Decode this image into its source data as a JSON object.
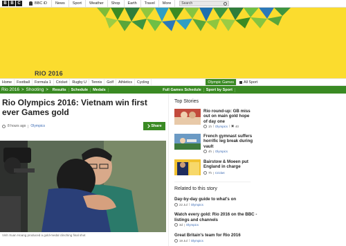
{
  "topbar": {
    "logo": [
      "B",
      "B",
      "C"
    ],
    "signin": "BBC iD",
    "nav": [
      "News",
      "Sport",
      "Weather",
      "Shop",
      "Earth",
      "Travel",
      "More"
    ],
    "search_placeholder": "Search"
  },
  "banner": {
    "title": "RIO 2016",
    "background": "#fbdc2e"
  },
  "sportnav": {
    "items": [
      "Home",
      "Football",
      "Formula 1",
      "Cricket",
      "Rugby U",
      "Tennis",
      "Golf",
      "Athletics",
      "Cycling"
    ],
    "active": "Olympic Games",
    "all_sport": "All Sport"
  },
  "section": {
    "title": "Rio 2016",
    "sub": "Shooting",
    "links": [
      "Results",
      "Schedule",
      "Medals"
    ],
    "right_links": [
      "Full Games Schedule",
      "Sport by Sport"
    ],
    "accent": "#3a8a23"
  },
  "article": {
    "headline": "Rio Olympics 2016: Vietnam win first ever Games gold",
    "time": "8 hours ago",
    "category": "Olympics",
    "share": "Share",
    "caption": "Vinh Xuan Hoang produced a gold-medal clinching final shot"
  },
  "top_stories": {
    "heading": "Top Stories",
    "items": [
      {
        "title": "Rio round-up: GB miss out on main gold hope of day one",
        "time": "1h",
        "category": "Olympics",
        "comments": "40"
      },
      {
        "title": "French gymnast suffers horrific leg break during vault",
        "time": "4h",
        "category": "Olympics"
      },
      {
        "title": "Bairstow & Moeen put England in charge",
        "time": "7h",
        "category": "Cricket"
      }
    ]
  },
  "related": {
    "heading": "Related to this story",
    "items": [
      {
        "title": "Day-by-day guide to what's on",
        "date": "22 Jul",
        "category": "Olympics"
      },
      {
        "title": "Watch every gold: Rio 2016 on the BBC - listings and channels",
        "date": "3d",
        "category": "Olympics"
      },
      {
        "title": "Great Britain's team for Rio 2016",
        "date": "19 Jul",
        "category": "Olympics"
      }
    ]
  }
}
